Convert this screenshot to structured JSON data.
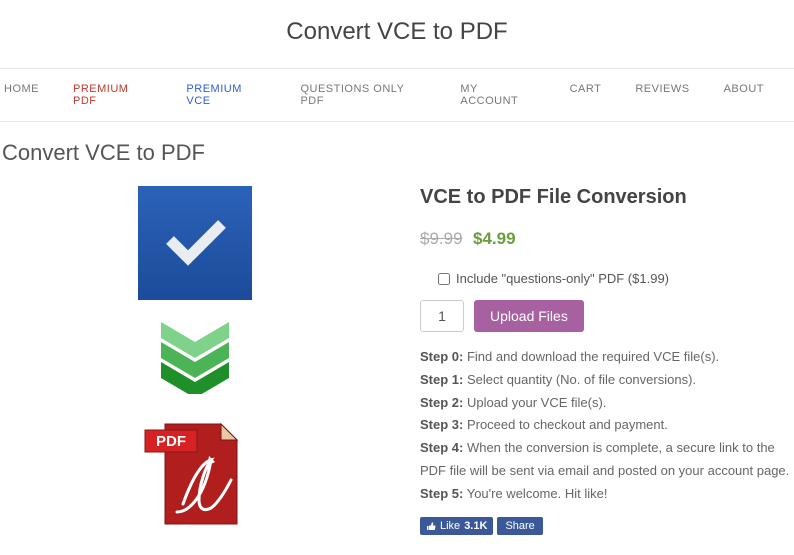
{
  "site_title": "Convert VCE to PDF",
  "nav": [
    {
      "label": "HOME",
      "cls": ""
    },
    {
      "label": "PREMIUM PDF",
      "cls": "premium-pdf"
    },
    {
      "label": "PREMIUM VCE",
      "cls": "premium-vce"
    },
    {
      "label": "QUESTIONS ONLY PDF",
      "cls": ""
    },
    {
      "label": "MY ACCOUNT",
      "cls": ""
    },
    {
      "label": "CART",
      "cls": ""
    },
    {
      "label": "REVIEWS",
      "cls": ""
    },
    {
      "label": "ABOUT",
      "cls": ""
    }
  ],
  "page_title": "Convert VCE to PDF",
  "product": {
    "title": "VCE to PDF File Conversion",
    "old_price": "$9.99",
    "new_price": "$4.99",
    "option_label": "Include \"questions-only\" PDF ($1.99)",
    "qty_value": "1",
    "upload_label": "Upload Files"
  },
  "steps": [
    {
      "label": "Step 0:",
      "text": " Find and download the required VCE file(s)."
    },
    {
      "label": "Step 1:",
      "text": " Select quantity (No. of file conversions)."
    },
    {
      "label": "Step 2:",
      "text": " Upload your VCE file(s)."
    },
    {
      "label": "Step 3:",
      "text": " Proceed to checkout and payment."
    },
    {
      "label": "Step 4:",
      "text": " When the conversion is complete, a secure link to the PDF file will be sent via email and posted on your account page."
    },
    {
      "label": "Step 5:",
      "text": " You're welcome. Hit like!"
    }
  ],
  "fb": {
    "like_label": "Like",
    "like_count": "3.1K",
    "share_label": "Share"
  }
}
